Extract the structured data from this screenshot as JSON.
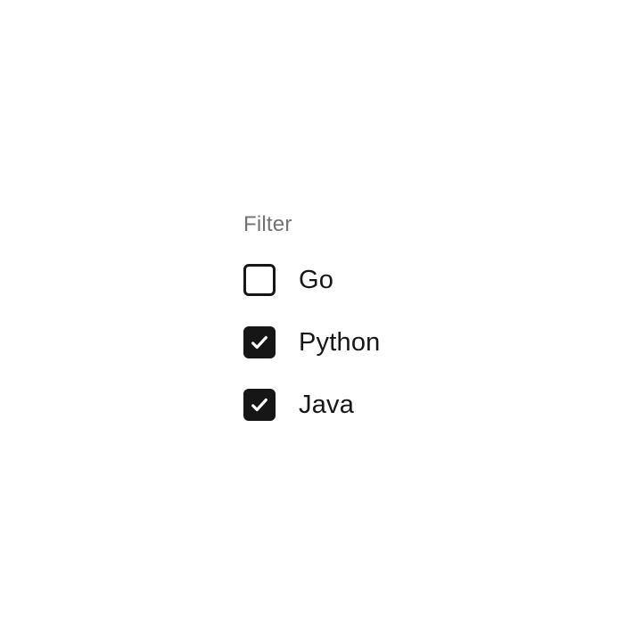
{
  "filter": {
    "heading": "Filter",
    "options": [
      {
        "label": "Go",
        "checked": false
      },
      {
        "label": "Python",
        "checked": true
      },
      {
        "label": "Java",
        "checked": true
      }
    ]
  }
}
